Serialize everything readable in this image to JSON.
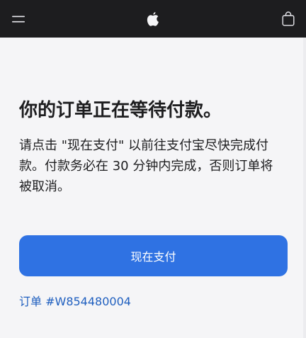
{
  "header": {
    "menu_icon": "hamburger-menu-icon",
    "logo_icon": "apple-logo-icon",
    "bag_icon": "shopping-bag-icon",
    "background": "#1d1d1f"
  },
  "main": {
    "title": "你的订单正在等待付款。",
    "message": "请点击 \"现在支付\" 以前往支付宝尽快完成付款。付款务必在 30 分钟内完成，否则订单将被取消。",
    "pay_button_label": "现在支付",
    "order_link": "订单 #W854480004"
  },
  "colors": {
    "accent": "#2f72e3",
    "link": "#1f5fbf",
    "page_background": "#f5f5f7",
    "text": "#1d1d1f"
  }
}
